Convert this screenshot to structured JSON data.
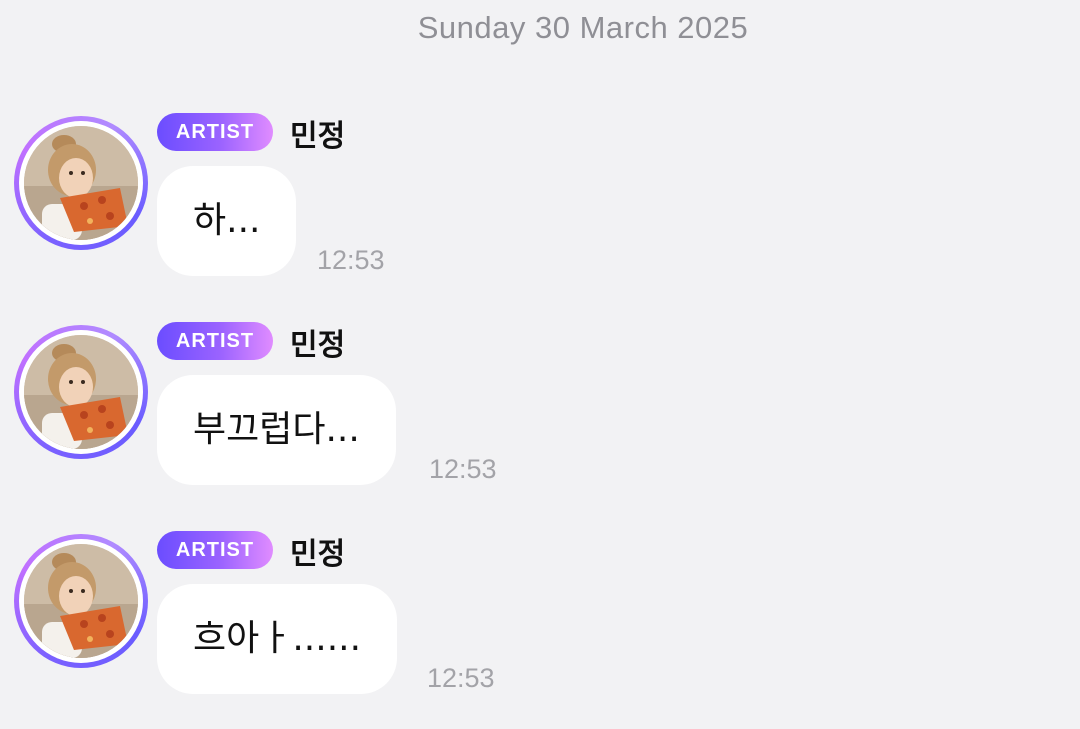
{
  "date_header": "Sunday 30 March 2025",
  "messages": [
    {
      "badge": "ARTIST",
      "sender": "민정",
      "text": "하...",
      "time": "12:53"
    },
    {
      "badge": "ARTIST",
      "sender": "민정",
      "text": "부끄럽다...",
      "time": "12:53"
    },
    {
      "badge": "ARTIST",
      "sender": "민정",
      "text": "흐아ㅏ......",
      "time": "12:53"
    }
  ],
  "colors": {
    "background": "#f2f2f4",
    "bubble": "#ffffff",
    "badge_gradient_start": "#6b4dff",
    "badge_gradient_end": "#e08cff",
    "avatar_ring": "#9b63ff",
    "muted_text": "#8f8f95"
  }
}
